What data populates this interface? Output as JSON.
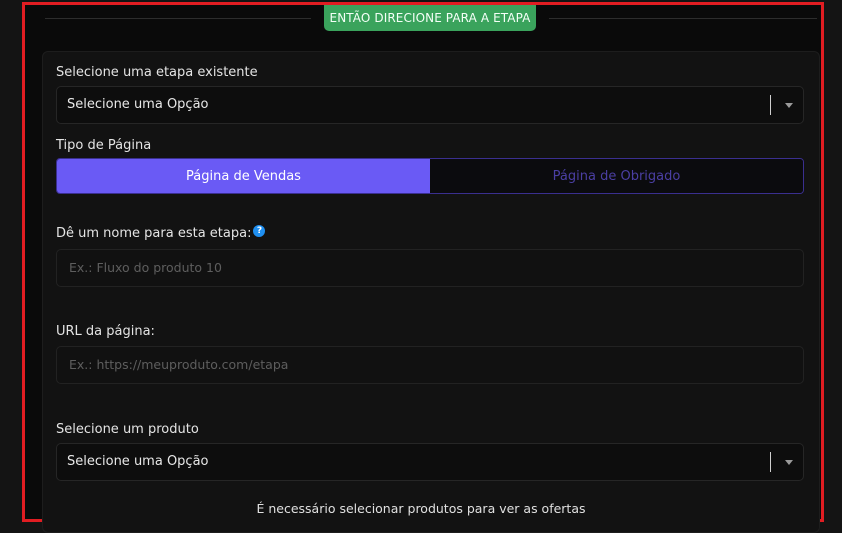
{
  "header": {
    "badge": "ENTÃO DIRECIONE PARA A ETAPA"
  },
  "step_select": {
    "label": "Selecione uma etapa existente",
    "value": "Selecione uma Opção"
  },
  "page_type": {
    "label": "Tipo de Página",
    "options": [
      "Página de Vendas",
      "Página de Obrigado"
    ],
    "active": "Página de Vendas"
  },
  "step_name": {
    "label": "Dê um nome para esta etapa:",
    "help_icon": "?",
    "placeholder": "Ex.: Fluxo do produto 10"
  },
  "page_url": {
    "label": "URL da página:",
    "placeholder": "Ex.: https://meuproduto.com/etapa"
  },
  "product_select": {
    "label": "Selecione um produto",
    "value": "Selecione uma Opção"
  },
  "footer_note": "É necessário selecionar produtos para ver as ofertas",
  "colors": {
    "accent": "#6a5af5",
    "badge": "#3aa35c",
    "highlight_border": "#e11d22",
    "help": "#1f8ff0"
  }
}
